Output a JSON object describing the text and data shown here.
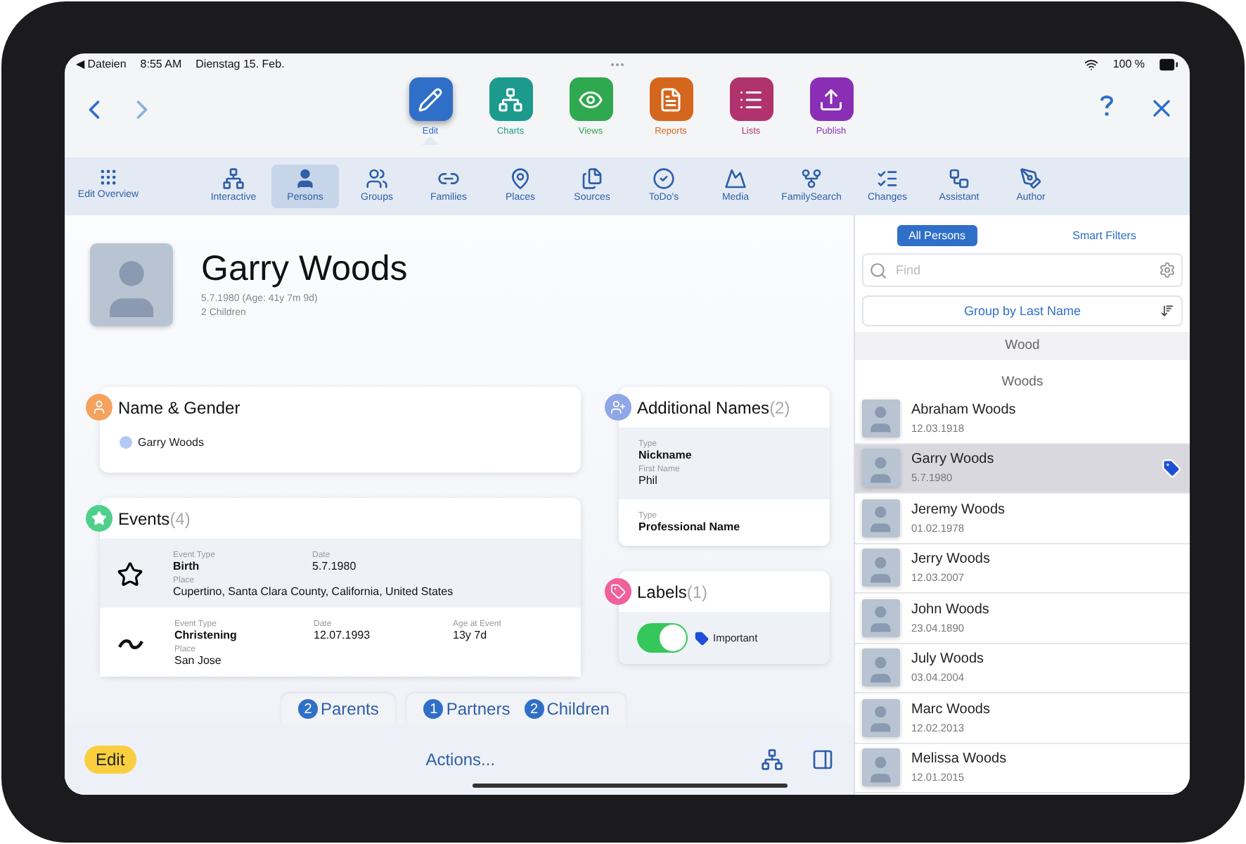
{
  "status_bar": {
    "back": "◀ Dateien",
    "time": "8:55 AM",
    "date": "Dienstag 15. Feb.",
    "battery": "100 %"
  },
  "main_tabs": [
    {
      "label": "Edit",
      "kind": "edit",
      "color": "#2f6fc8",
      "selected": true
    },
    {
      "label": "Charts",
      "kind": "charts",
      "color": "#1c9a8e",
      "selected": false
    },
    {
      "label": "Views",
      "kind": "views",
      "color": "#2fa84f",
      "selected": false
    },
    {
      "label": "Reports",
      "kind": "reports",
      "color": "#d5661e",
      "selected": false
    },
    {
      "label": "Lists",
      "kind": "lists",
      "color": "#b0336d",
      "selected": false
    },
    {
      "label": "Publish",
      "kind": "publish",
      "color": "#8a2fb5",
      "selected": false
    }
  ],
  "overview": {
    "label": "Edit Overview"
  },
  "sub_tabs": [
    {
      "label": "Interactive",
      "kind": "interactive",
      "selected": false
    },
    {
      "label": "Persons",
      "kind": "persons",
      "selected": true
    },
    {
      "label": "Groups",
      "kind": "groups",
      "selected": false
    },
    {
      "label": "Families",
      "kind": "families",
      "selected": false
    },
    {
      "label": "Places",
      "kind": "places",
      "selected": false
    },
    {
      "label": "Sources",
      "kind": "sources",
      "selected": false
    },
    {
      "label": "ToDo's",
      "kind": "todos",
      "selected": false
    },
    {
      "label": "Media",
      "kind": "media",
      "selected": false
    },
    {
      "label": "FamilySearch",
      "kind": "familysearch",
      "selected": false
    },
    {
      "label": "Changes",
      "kind": "changes",
      "selected": false
    },
    {
      "label": "Assistant",
      "kind": "assistant",
      "selected": false
    },
    {
      "label": "Author",
      "kind": "author",
      "selected": false
    }
  ],
  "person": {
    "name": "Garry Woods",
    "details": [
      "5.7.1980 (Age: 41y 7m 9d)",
      "2 Children"
    ]
  },
  "left_cards": [
    {
      "kind": "name_gender",
      "title": "Name & Gender",
      "color": "#f5a25d",
      "name": "Garry Woods"
    },
    {
      "kind": "events",
      "title": "Events",
      "count": "(4)",
      "color": "#4fcf8c",
      "events": [
        {
          "kind": "birth",
          "selected": true,
          "fields": [
            {
              "label": "Event Type",
              "value": "Birth"
            },
            {
              "label": "Date",
              "value": "5.7.1980"
            }
          ],
          "place_label": "Place",
          "place": "Cupertino, Santa Clara County, California, United States"
        },
        {
          "kind": "christening",
          "selected": false,
          "fields": [
            {
              "label": "Event Type",
              "value": "Christening"
            },
            {
              "label": "Date",
              "value": "12.07.1993"
            },
            {
              "label": "Age at Event",
              "value": "13y 7d"
            }
          ],
          "place_label": "Place",
          "place": "San Jose"
        }
      ]
    }
  ],
  "right_cards": [
    {
      "kind": "additional_names",
      "title": "Additional Names",
      "count": "(2)",
      "color": "#8fa6e8",
      "names": [
        {
          "fields": [
            {
              "label": "Type",
              "value": "Nickname"
            },
            {
              "label": "First Name",
              "value": "Phil"
            }
          ]
        },
        {
          "fields": [
            {
              "label": "Type",
              "value": "Professional Name"
            }
          ]
        }
      ]
    },
    {
      "kind": "labels",
      "title": "Labels",
      "count": "(1)",
      "color": "#f0609a",
      "labels": [
        {
          "label": "Important",
          "on": true
        }
      ]
    }
  ],
  "relation_tabs": [
    [
      {
        "count": "2",
        "label": "Parents"
      }
    ],
    [
      {
        "count": "1",
        "label": "Partners"
      },
      {
        "count": "2",
        "label": "Children"
      }
    ]
  ],
  "bottom_bar": {
    "edit": "Edit",
    "actions": "Actions..."
  },
  "sidebar": {
    "segments": [
      {
        "label": "All Persons",
        "selected": true
      },
      {
        "label": "Smart Filters",
        "selected": false
      }
    ],
    "search": {
      "placeholder": "Find"
    },
    "group_button": "Group by Last Name",
    "sections": [
      {
        "title": "Wood"
      },
      {
        "title": "Woods",
        "persons": [
          {
            "name": "Abraham Woods",
            "date": "12.03.1918",
            "selected": false,
            "labeled": false
          },
          {
            "name": "Garry Woods",
            "date": "5.7.1980",
            "selected": true,
            "labeled": true
          },
          {
            "name": "Jeremy Woods",
            "date": "01.02.1978",
            "selected": false,
            "labeled": false
          },
          {
            "name": "Jerry Woods",
            "date": "12.03.2007",
            "selected": false,
            "labeled": false
          },
          {
            "name": "John Woods",
            "date": "23.04.1890",
            "selected": false,
            "labeled": false
          },
          {
            "name": "July Woods",
            "date": "03.04.2004",
            "selected": false,
            "labeled": false
          },
          {
            "name": "Marc Woods",
            "date": "12.02.2013",
            "selected": false,
            "labeled": false
          },
          {
            "name": "Melissa Woods",
            "date": "12.01.2015",
            "selected": false,
            "labeled": false
          }
        ]
      }
    ]
  }
}
